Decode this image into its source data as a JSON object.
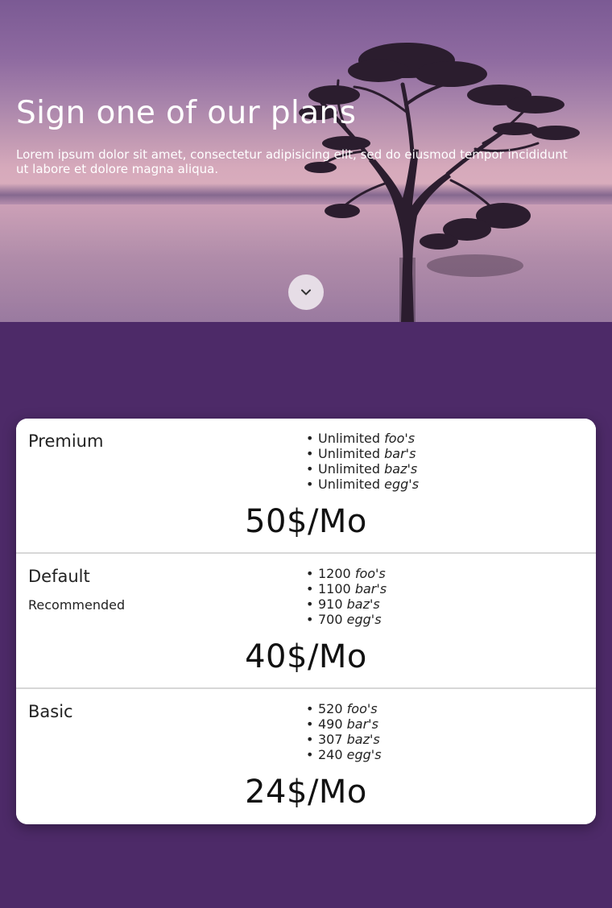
{
  "hero": {
    "title": "Sign one of our plans",
    "subtitle": "Lorem ipsum dolor sit amet, consectetur adipisicing elit, sed do eiusmod tempor incididunt ut labore et dolore magna aliqua.",
    "scroll_icon": "chevron-down-icon"
  },
  "plans": [
    {
      "name": "Premium",
      "tag": "",
      "features": [
        {
          "qty": "Unlimited",
          "item": "foo's"
        },
        {
          "qty": "Unlimited",
          "item": "bar's"
        },
        {
          "qty": "Unlimited",
          "item": "baz's"
        },
        {
          "qty": "Unlimited",
          "item": "egg's"
        }
      ],
      "price": "50$/Mo"
    },
    {
      "name": "Default",
      "tag": "Recommended",
      "features": [
        {
          "qty": "1200",
          "item": "foo's"
        },
        {
          "qty": "1100",
          "item": "bar's"
        },
        {
          "qty": "910",
          "item": "baz's"
        },
        {
          "qty": "700",
          "item": "egg's"
        }
      ],
      "price": "40$/Mo"
    },
    {
      "name": "Basic",
      "tag": "",
      "features": [
        {
          "qty": "520",
          "item": "foo's"
        },
        {
          "qty": "490",
          "item": "bar's"
        },
        {
          "qty": "307",
          "item": "baz's"
        },
        {
          "qty": "240",
          "item": "egg's"
        }
      ],
      "price": "24$/Mo"
    }
  ],
  "colors": {
    "page_background": "#4d2a68",
    "card_background": "#ffffff",
    "scroll_button": "#e6dde6"
  }
}
